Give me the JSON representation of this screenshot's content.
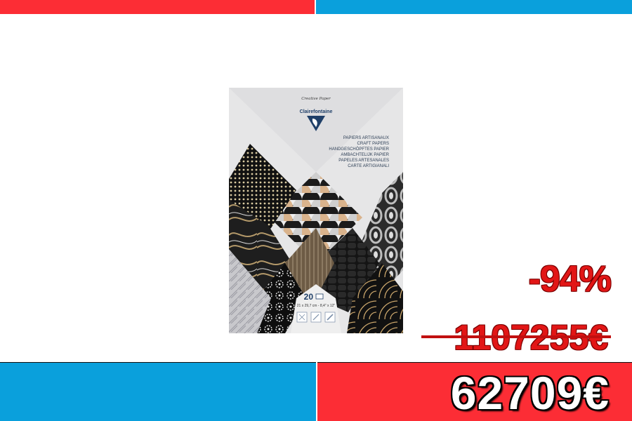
{
  "pricing": {
    "discount": "-94%",
    "old_price": "1107255€",
    "new_price": "62709€"
  },
  "product": {
    "line_name": "Creative Paper",
    "brand": "Clairefontaine",
    "descriptions": [
      "PAPIERS ARTISANAUX",
      "CRAFT PAPERS",
      "HANDGESCHÖPFTES PAPIER",
      "AMBACHTELIJK PAPIER",
      "PAPELES ARTESANALES",
      "CARTE ARTIGIANALI"
    ],
    "sheet_count": "20",
    "size": "21 x 29,7 cm - 8,4\" x 12\""
  },
  "colors": {
    "red": "#fc2d35",
    "blue": "#0aa0dc"
  }
}
